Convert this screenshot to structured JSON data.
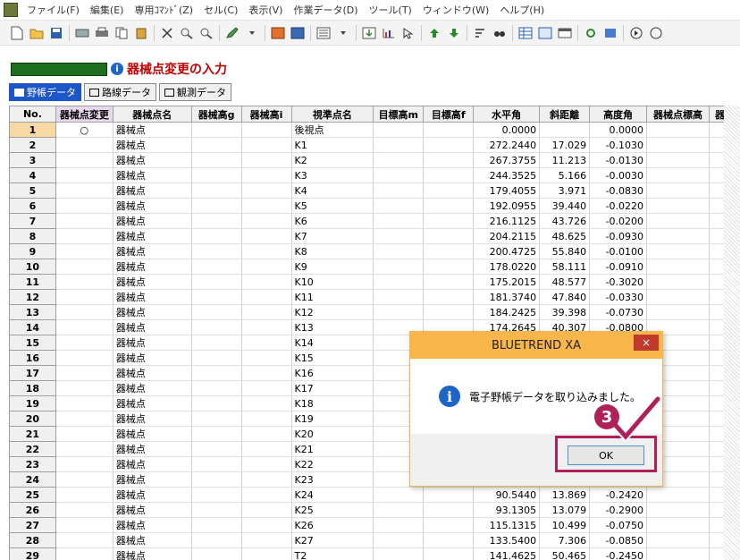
{
  "menu": [
    "ファイル(F)",
    "編集(E)",
    "専用ｺﾏﾝﾄﾞ(Z)",
    "セル(C)",
    "表示(V)",
    "作業データ(D)",
    "ツール(T)",
    "ウィンドウ(W)",
    "ヘルプ(H)"
  ],
  "page_title": "器械点変更の入力",
  "tabs": [
    {
      "label": "野帳データ"
    },
    {
      "label": "路線データ"
    },
    {
      "label": "観測データ"
    }
  ],
  "columns": [
    "No.",
    "器械点変更",
    "器械点名",
    "器械高g",
    "器械高i",
    "視準点名",
    "目標高m",
    "目標高f",
    "水平角",
    "斜距離",
    "高度角",
    "器械点標高",
    "器"
  ],
  "rows": [
    {
      "no": "1",
      "change": "○",
      "inst": "器械点",
      "target": "後視点",
      "hangle": "0.0000",
      "dist": "",
      "vangle": "0.0000"
    },
    {
      "no": "2",
      "change": "",
      "inst": "器械点",
      "target": "K1",
      "hangle": "272.2440",
      "dist": "17.029",
      "vangle": "-0.1030"
    },
    {
      "no": "3",
      "change": "",
      "inst": "器械点",
      "target": "K2",
      "hangle": "267.3755",
      "dist": "11.213",
      "vangle": "-0.0130"
    },
    {
      "no": "4",
      "change": "",
      "inst": "器械点",
      "target": "K3",
      "hangle": "244.3525",
      "dist": "5.166",
      "vangle": "-0.0030"
    },
    {
      "no": "5",
      "change": "",
      "inst": "器械点",
      "target": "K4",
      "hangle": "179.4055",
      "dist": "3.971",
      "vangle": "-0.0830"
    },
    {
      "no": "6",
      "change": "",
      "inst": "器械点",
      "target": "K5",
      "hangle": "192.0955",
      "dist": "39.440",
      "vangle": "-0.0220"
    },
    {
      "no": "7",
      "change": "",
      "inst": "器械点",
      "target": "K6",
      "hangle": "216.1125",
      "dist": "43.726",
      "vangle": "-0.0200"
    },
    {
      "no": "8",
      "change": "",
      "inst": "器械点",
      "target": "K7",
      "hangle": "204.2115",
      "dist": "48.625",
      "vangle": "-0.0930"
    },
    {
      "no": "9",
      "change": "",
      "inst": "器械点",
      "target": "K8",
      "hangle": "200.4725",
      "dist": "55.840",
      "vangle": "-0.0100"
    },
    {
      "no": "10",
      "change": "",
      "inst": "器械点",
      "target": "K9",
      "hangle": "178.0220",
      "dist": "58.111",
      "vangle": "-0.0910"
    },
    {
      "no": "11",
      "change": "",
      "inst": "器械点",
      "target": "K10",
      "hangle": "175.2015",
      "dist": "48.577",
      "vangle": "-0.3020"
    },
    {
      "no": "12",
      "change": "",
      "inst": "器械点",
      "target": "K11",
      "hangle": "181.3740",
      "dist": "47.840",
      "vangle": "-0.0330"
    },
    {
      "no": "13",
      "change": "",
      "inst": "器械点",
      "target": "K12",
      "hangle": "184.2425",
      "dist": "39.398",
      "vangle": "-0.0730"
    },
    {
      "no": "14",
      "change": "",
      "inst": "器械点",
      "target": "K13",
      "hangle": "174.2645",
      "dist": "40.307",
      "vangle": "-0.0800"
    },
    {
      "no": "15",
      "change": "",
      "inst": "器械点",
      "target": "K14",
      "hangle": "",
      "dist": "",
      "vangle": ""
    },
    {
      "no": "16",
      "change": "",
      "inst": "器械点",
      "target": "K15",
      "hangle": "",
      "dist": "",
      "vangle": ""
    },
    {
      "no": "17",
      "change": "",
      "inst": "器械点",
      "target": "K16",
      "hangle": "",
      "dist": "",
      "vangle": ""
    },
    {
      "no": "18",
      "change": "",
      "inst": "器械点",
      "target": "K17",
      "hangle": "",
      "dist": "",
      "vangle": ""
    },
    {
      "no": "19",
      "change": "",
      "inst": "器械点",
      "target": "K18",
      "hangle": "",
      "dist": "",
      "vangle": ""
    },
    {
      "no": "20",
      "change": "",
      "inst": "器械点",
      "target": "K19",
      "hangle": "",
      "dist": "",
      "vangle": ""
    },
    {
      "no": "21",
      "change": "",
      "inst": "器械点",
      "target": "K20",
      "hangle": "",
      "dist": "",
      "vangle": ""
    },
    {
      "no": "22",
      "change": "",
      "inst": "器械点",
      "target": "K21",
      "hangle": "",
      "dist": "",
      "vangle": ""
    },
    {
      "no": "23",
      "change": "",
      "inst": "器械点",
      "target": "K22",
      "hangle": "",
      "dist": "",
      "vangle": ""
    },
    {
      "no": "24",
      "change": "",
      "inst": "器械点",
      "target": "K23",
      "hangle": "",
      "dist": "",
      "vangle": ""
    },
    {
      "no": "25",
      "change": "",
      "inst": "器械点",
      "target": "K24",
      "hangle": "90.5440",
      "dist": "13.869",
      "vangle": "-0.2420"
    },
    {
      "no": "26",
      "change": "",
      "inst": "器械点",
      "target": "K25",
      "hangle": "93.1305",
      "dist": "13.079",
      "vangle": "-0.2900"
    },
    {
      "no": "27",
      "change": "",
      "inst": "器械点",
      "target": "K26",
      "hangle": "115.1315",
      "dist": "10.499",
      "vangle": "-0.0750"
    },
    {
      "no": "28",
      "change": "",
      "inst": "器械点",
      "target": "K27",
      "hangle": "133.5400",
      "dist": "7.306",
      "vangle": "-0.0850"
    },
    {
      "no": "29",
      "change": "",
      "inst": "器械点",
      "target": "T2",
      "hangle": "141.4625",
      "dist": "50.465",
      "vangle": "-0.2450"
    }
  ],
  "dialog": {
    "title": "BLUETREND XA",
    "message": "電子野帳データを取り込みました。",
    "ok_label": "OK",
    "close_label": "×"
  },
  "annotation": {
    "step": "3"
  },
  "colors": {
    "accent": "#b0205a",
    "dialog_title": "#f9b64a",
    "tab_active": "#1c56c7",
    "title_text": "#c00000"
  }
}
